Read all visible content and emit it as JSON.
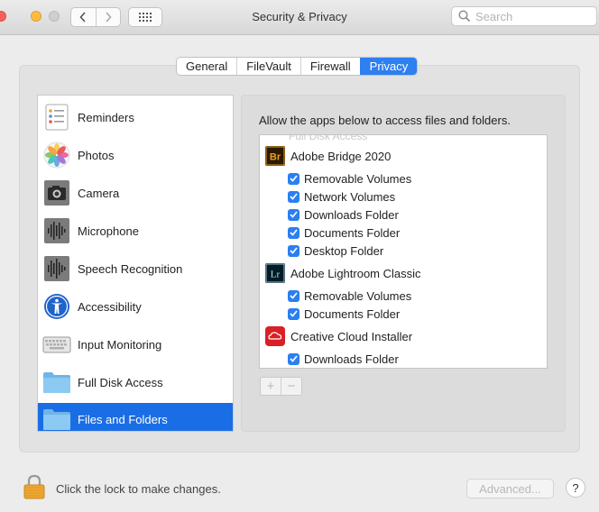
{
  "window": {
    "title": "Security & Privacy"
  },
  "search": {
    "placeholder": "Search"
  },
  "tabs": [
    {
      "label": "General",
      "active": false
    },
    {
      "label": "FileVault",
      "active": false
    },
    {
      "label": "Firewall",
      "active": false
    },
    {
      "label": "Privacy",
      "active": true
    }
  ],
  "sidebar": {
    "items": [
      {
        "label": "Reminders",
        "icon": "reminders-icon"
      },
      {
        "label": "Photos",
        "icon": "photos-icon"
      },
      {
        "label": "Camera",
        "icon": "camera-icon"
      },
      {
        "label": "Microphone",
        "icon": "microphone-icon"
      },
      {
        "label": "Speech Recognition",
        "icon": "speech-recognition-icon"
      },
      {
        "label": "Accessibility",
        "icon": "accessibility-icon"
      },
      {
        "label": "Input Monitoring",
        "icon": "keyboard-icon"
      },
      {
        "label": "Full Disk Access",
        "icon": "folder-icon"
      },
      {
        "label": "Files and Folders",
        "icon": "folder-icon",
        "selected": true
      }
    ]
  },
  "main": {
    "description": "Allow the apps below to access files and folders.",
    "partial_row": "Full Disk Access",
    "apps": [
      {
        "name": "Adobe Bridge 2020",
        "icon": "adobe-bridge-icon",
        "icon_text": "Br",
        "permissions": [
          "Removable Volumes",
          "Network Volumes",
          "Downloads Folder",
          "Documents Folder",
          "Desktop Folder"
        ]
      },
      {
        "name": "Adobe Lightroom Classic",
        "icon": "adobe-lightroom-icon",
        "icon_text": "Lr",
        "permissions": [
          "Removable Volumes",
          "Documents Folder"
        ]
      },
      {
        "name": "Creative Cloud Installer",
        "icon": "creative-cloud-icon",
        "permissions": [
          "Downloads Folder"
        ]
      }
    ],
    "add_label": "+",
    "remove_label": "−"
  },
  "footer": {
    "lock_text": "Click the lock to make changes.",
    "advanced_label": "Advanced...",
    "help_label": "?"
  },
  "colors": {
    "accent": "#2e7ff0",
    "selection": "#1a6ee5"
  }
}
